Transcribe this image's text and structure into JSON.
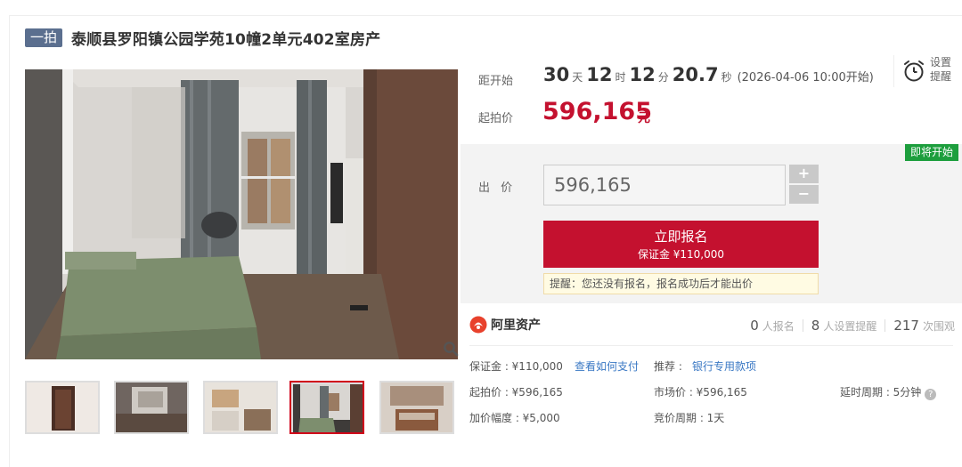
{
  "header": {
    "tag": "一拍",
    "title": "泰顺县罗阳镇公园学苑10幢2单元402室房产"
  },
  "countdown": {
    "label": "距开始",
    "days": "30",
    "days_unit": "天",
    "hours": "12",
    "hours_unit": "时",
    "minutes": "12",
    "minutes_unit": "分",
    "seconds": "20.7",
    "seconds_unit": "秒",
    "start_time": "(2026-04-06 10:00开始)"
  },
  "reminder": {
    "line1": "设置",
    "line2": "提醒"
  },
  "start_price": {
    "label": "起拍价",
    "value": "596,165",
    "unit": "元"
  },
  "bid": {
    "badge": "即将开始",
    "label": "出 价",
    "input_value": "596,165",
    "plus": "+",
    "minus": "−",
    "signup_label": "立即报名",
    "signup_deposit": "保证金 ¥110,000",
    "tip": "提醒：您还没有报名，报名成功后才能出价"
  },
  "brand": {
    "name": "阿里资产"
  },
  "stats": {
    "signups": "0",
    "signups_label": "人报名",
    "reminders": "8",
    "reminders_label": "人设置提醒",
    "views": "217",
    "views_label": "次围观"
  },
  "details": {
    "deposit": "保证金 : ¥110,000",
    "pay_link": "查看如何支付",
    "recommend_label": "推荐 :",
    "recommend_link": "银行专用款项",
    "start_price": "起拍价 : ¥596,165",
    "market_price": "市场价 : ¥596,165",
    "delay_period": "延时周期 : 5分钟",
    "increment": "加价幅度 : ¥5,000",
    "bidding_period": "竞价周期 : 1天"
  },
  "colors": {
    "accent_red": "#c4112f",
    "badge_green": "#1d9e3d",
    "tag_blue": "#5b6f8f",
    "link_blue": "#3a78c4"
  },
  "icons": {
    "zoom": "search-icon",
    "reminder": "alarm-clock-icon",
    "brand": "ali-logo-icon",
    "help": "question-icon"
  }
}
